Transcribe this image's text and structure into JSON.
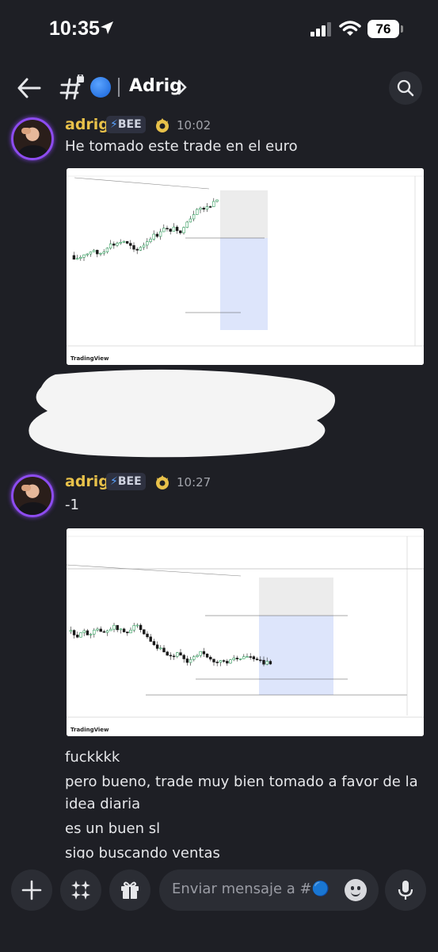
{
  "status_bar": {
    "time": "10:35",
    "battery": "76"
  },
  "header": {
    "channel_name": "Adrig"
  },
  "messages": [
    {
      "author": "adrig",
      "badge": "BEE",
      "time": "10:02",
      "lines": [
        "He tomado este trade en el euro"
      ],
      "chart": {
        "brand": "TradingView"
      }
    },
    {
      "author": "adrig",
      "badge": "BEE",
      "time": "10:27",
      "lines": [
        "-1"
      ],
      "chart": {
        "brand": "TradingView"
      }
    }
  ],
  "followups": [
    "fuckkkk",
    "pero bueno, trade muy bien tomado a favor de la",
    "idea diaria",
    "es un buen sl",
    "sigo buscando ventas"
  ],
  "composer": {
    "placeholder": "Enviar mensaje a #🔵..."
  },
  "icons": [
    "location-arrow-icon",
    "signal-icon",
    "wifi-icon",
    "back-arrow-icon",
    "channel-hash-lock-icon",
    "chevron-right-icon",
    "search-icon",
    "plus-icon",
    "apps-icon",
    "gift-icon",
    "emoji-icon",
    "microphone-icon",
    "crown-badge-icon"
  ],
  "colors": {
    "background": "#1e1f25",
    "author": "#e8c14a",
    "accent": "#5aa3ff",
    "avatar_ring": "#8d4cf0"
  }
}
